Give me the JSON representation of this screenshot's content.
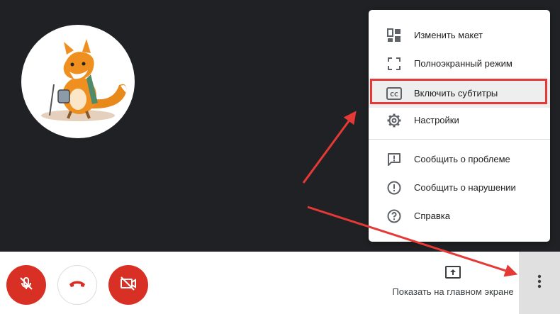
{
  "menu": {
    "items": [
      {
        "label": "Изменить макет",
        "icon": "layout-icon"
      },
      {
        "label": "Полноэкранный режим",
        "icon": "fullscreen-icon"
      },
      {
        "label": "Включить субтитры",
        "icon": "captions-icon"
      },
      {
        "label": "Настройки",
        "icon": "gear-icon"
      },
      {
        "label": "Сообщить о проблеме",
        "icon": "feedback-icon"
      },
      {
        "label": "Сообщить о нарушении",
        "icon": "report-icon"
      },
      {
        "label": "Справка",
        "icon": "help-icon"
      }
    ],
    "highlighted_index": 2
  },
  "bottom_bar": {
    "present_label": "Показать на главном экране",
    "mic_state": "muted",
    "camera_state": "off"
  },
  "colors": {
    "stage_bg": "#202124",
    "danger": "#d93025",
    "annotation": "#e53935",
    "more_bg": "#e0e0e0"
  }
}
